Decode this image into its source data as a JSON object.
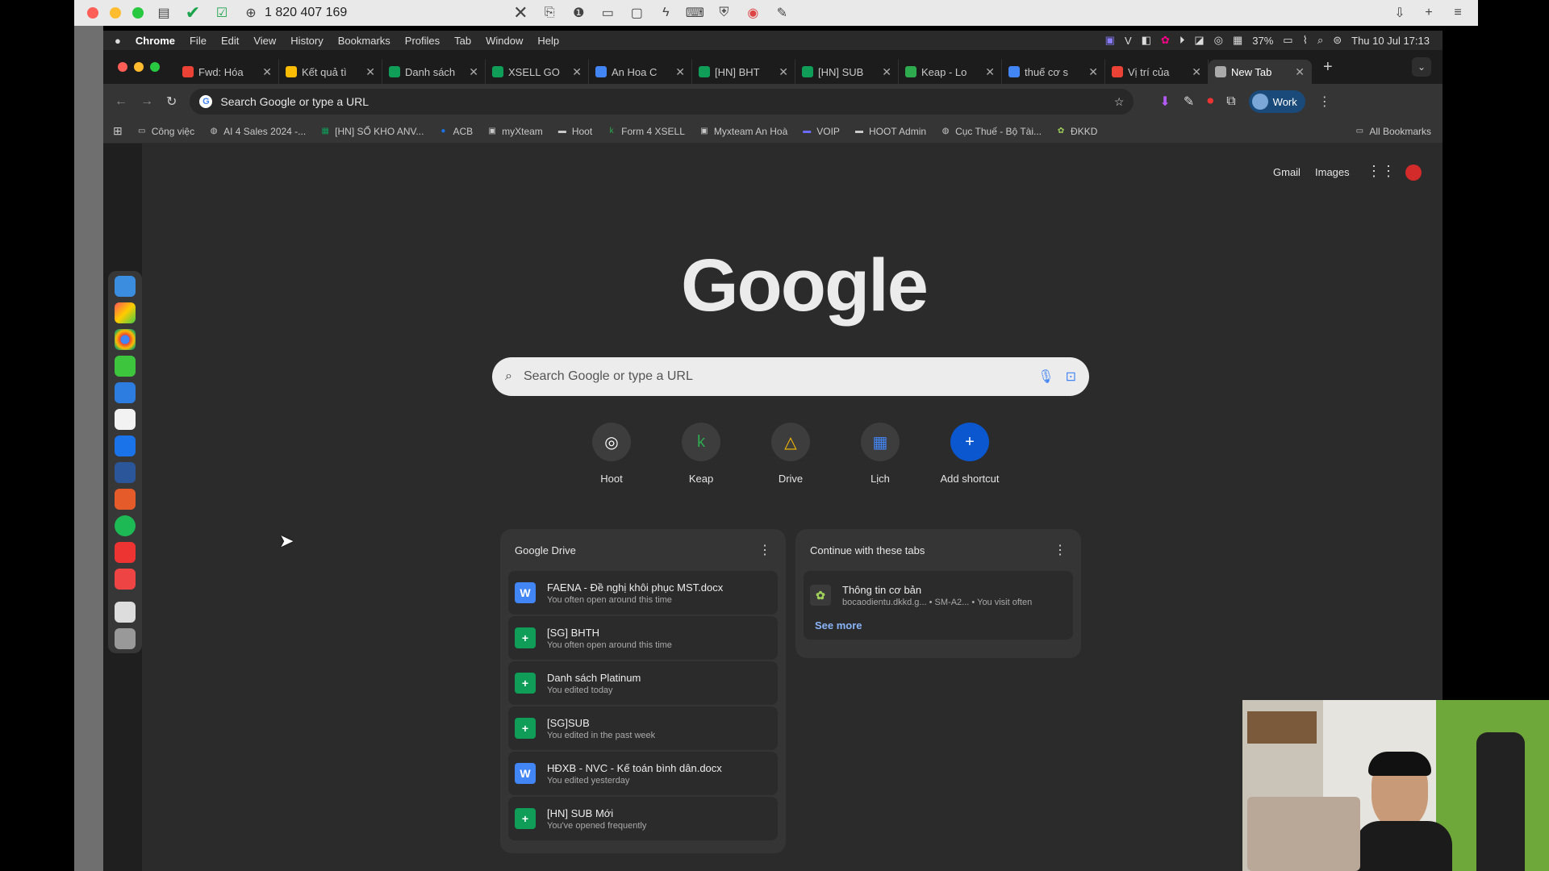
{
  "recorder": {
    "phone": "1 820 407 169"
  },
  "mac_menu": {
    "app": "Chrome",
    "items": [
      "File",
      "Edit",
      "View",
      "History",
      "Bookmarks",
      "Profiles",
      "Tab",
      "Window",
      "Help"
    ],
    "battery": "37%",
    "datetime": "Thu 10 Jul  17:13"
  },
  "tabs": [
    {
      "title": "Fwd: Hóa",
      "icon": "gmail-icon",
      "color": "#ea4335"
    },
    {
      "title": "Kết quả tì",
      "icon": "drive-icon",
      "color": "#fbbc04"
    },
    {
      "title": "Danh sách",
      "icon": "sheets-icon",
      "color": "#0f9d58"
    },
    {
      "title": "XSELL GO",
      "icon": "sheets-icon",
      "color": "#0f9d58"
    },
    {
      "title": "An Hoa C",
      "icon": "calendar-icon",
      "color": "#4285f4"
    },
    {
      "title": "[HN] BHT",
      "icon": "sheets-icon",
      "color": "#0f9d58"
    },
    {
      "title": "[HN] SUB",
      "icon": "sheets-icon",
      "color": "#0f9d58"
    },
    {
      "title": "Keap - Lo",
      "icon": "keap-icon",
      "color": "#2eaa4f"
    },
    {
      "title": "thuế cơ s",
      "icon": "google-icon",
      "color": "#4285f4"
    },
    {
      "title": "Vị trí của",
      "icon": "maps-icon",
      "color": "#ea4335"
    },
    {
      "title": "New Tab",
      "icon": "chrome-icon",
      "color": "#aaaaaa",
      "active": true
    }
  ],
  "toolbar": {
    "omnibox_placeholder": "Search Google or type a URL",
    "profile_label": "Work"
  },
  "bookmarks": [
    {
      "label": "Công việc",
      "icon": "folder-icon"
    },
    {
      "label": "AI 4 Sales 2024 -...",
      "icon": "globe-icon"
    },
    {
      "label": "[HN] SỔ KHO ANV...",
      "icon": "sheets-icon"
    },
    {
      "label": "ACB",
      "icon": "acb-icon"
    },
    {
      "label": "myXteam",
      "icon": "xteam-icon"
    },
    {
      "label": "Hoot",
      "icon": "hoot-icon"
    },
    {
      "label": "Form 4 XSELL",
      "icon": "keap-icon"
    },
    {
      "label": "Myxteam An Hoà",
      "icon": "xteam-icon"
    },
    {
      "label": "VOIP",
      "icon": "voip-icon"
    },
    {
      "label": "HOOT Admin",
      "icon": "hoot-icon"
    },
    {
      "label": "Cục Thuế - Bộ Tài...",
      "icon": "globe-icon"
    },
    {
      "label": "ĐKKD",
      "icon": "dkkd-icon"
    }
  ],
  "all_bookmarks": "All Bookmarks",
  "ntp": {
    "gmail": "Gmail",
    "images": "Images",
    "logo": "Google",
    "search_placeholder": "Search Google or type a URL",
    "shortcuts": [
      {
        "label": "Hoot",
        "icon": "hoot-icon"
      },
      {
        "label": "Keap",
        "icon": "keap-icon"
      },
      {
        "label": "Drive",
        "icon": "drive-icon"
      },
      {
        "label": "Lịch",
        "icon": "calendar-icon"
      },
      {
        "label": "Add shortcut",
        "icon": "plus-icon"
      }
    ],
    "drive_card": {
      "title": "Google Drive",
      "items": [
        {
          "title": "FAENA - Đề nghị khôi phục MST.docx",
          "sub": "You often open around this time",
          "type": "W",
          "color": "#4285f4"
        },
        {
          "title": "[SG] BHTH",
          "sub": "You often open around this time",
          "type": "+",
          "color": "#0f9d58"
        },
        {
          "title": "Danh sách Platinum",
          "sub": "You edited today",
          "type": "+",
          "color": "#0f9d58"
        },
        {
          "title": "[SG]SUB",
          "sub": "You edited in the past week",
          "type": "+",
          "color": "#0f9d58"
        },
        {
          "title": "HĐXB - NVC - Kế toán bình dân.docx",
          "sub": "You edited yesterday",
          "type": "W",
          "color": "#4285f4"
        },
        {
          "title": "[HN] SUB Mới",
          "sub": "You've opened frequently",
          "type": "+",
          "color": "#0f9d58"
        }
      ]
    },
    "tabs_card": {
      "title": "Continue with these tabs",
      "item_title": "Thông tin cơ bản",
      "item_sub1": "bocaodientu.dkkd.g...",
      "item_sub2": "• SM-A2...",
      "item_sub3": "• You visit often",
      "see_more": "See more"
    }
  }
}
